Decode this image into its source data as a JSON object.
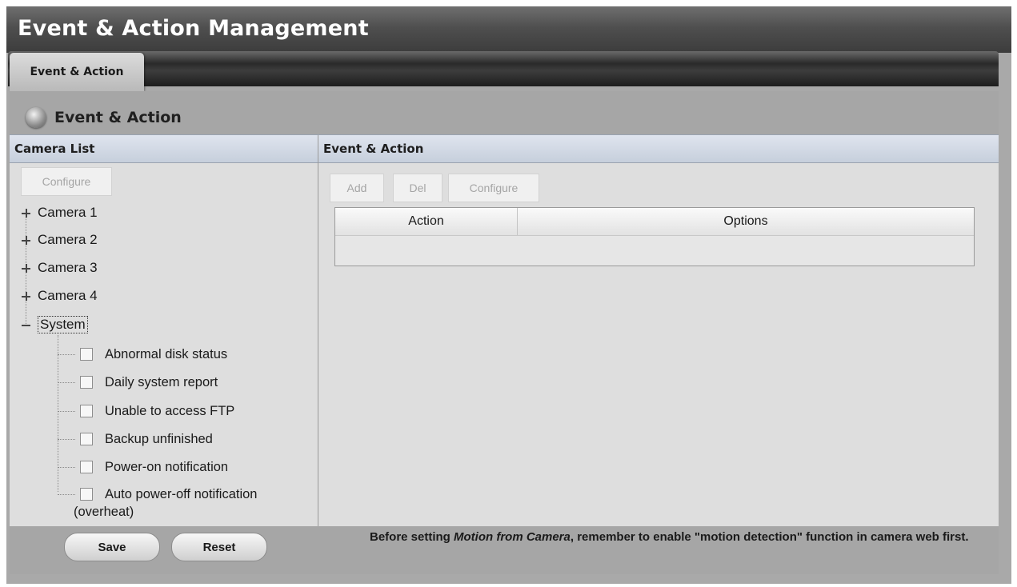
{
  "header": {
    "title": "Event & Action Management"
  },
  "tabs": [
    {
      "label": "Event & Action"
    }
  ],
  "section": {
    "title": "Event & Action",
    "icon": "event-globe-icon"
  },
  "camera_list": {
    "header": "Camera List",
    "configure_button": "Configure",
    "tree": [
      {
        "label": "Camera 1",
        "expanded": false
      },
      {
        "label": "Camera 2",
        "expanded": false
      },
      {
        "label": "Camera 3",
        "expanded": false
      },
      {
        "label": "Camera 4",
        "expanded": false
      },
      {
        "label": "System",
        "expanded": true
      }
    ],
    "system_items": [
      {
        "label": "Abnormal disk status",
        "checked": false
      },
      {
        "label": "Daily system report",
        "checked": false
      },
      {
        "label": "Unable to access FTP",
        "checked": false
      },
      {
        "label": "Backup unfinished",
        "checked": false
      },
      {
        "label": "Power-on notification",
        "checked": false
      },
      {
        "label": "Auto power-off notification",
        "checked": false
      }
    ],
    "system_item_wrap": "(overheat)"
  },
  "event_action": {
    "header": "Event & Action",
    "buttons": {
      "add": "Add",
      "del": "Del",
      "configure": "Configure"
    },
    "table": {
      "columns": [
        "Action",
        "Options"
      ],
      "rows": []
    }
  },
  "footer": {
    "save": "Save",
    "reset": "Reset",
    "note_before": "Before setting ",
    "note_emph": "Motion from Camera",
    "note_after": ", remember to enable \"motion detection\" function in camera web first."
  }
}
